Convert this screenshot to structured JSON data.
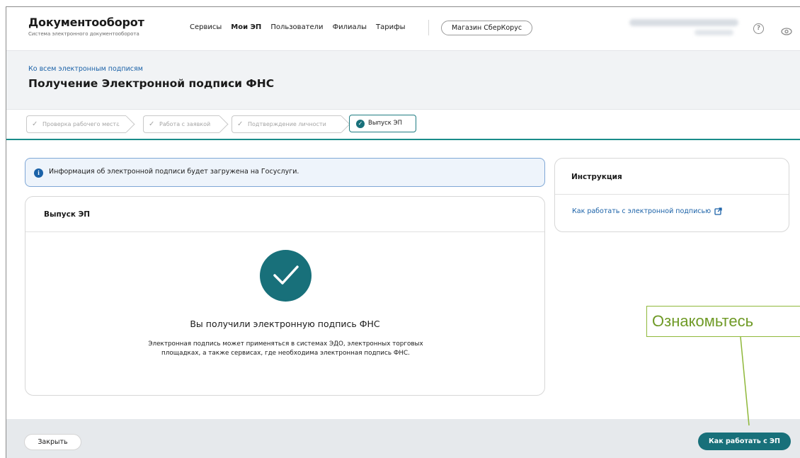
{
  "header": {
    "logo_title": "Документооборот",
    "logo_subtitle": "Система электронного документооборота",
    "nav": [
      {
        "label": "Сервисы",
        "active": false
      },
      {
        "label": "Мои ЭП",
        "active": true
      },
      {
        "label": "Пользователи",
        "active": false
      },
      {
        "label": "Филиалы",
        "active": false
      },
      {
        "label": "Тарифы",
        "active": false
      }
    ],
    "shop_button": "Магазин СберКорус",
    "help_icon": "help-circle-icon",
    "eye_icon": "eye-icon"
  },
  "title_band": {
    "back_link": "Ко всем электронным подписям",
    "page_title": "Получение Электронной подписи ФНС"
  },
  "steps": [
    {
      "label": "Проверка рабочего места",
      "state": "done"
    },
    {
      "label": "Работа с заявкой",
      "state": "done"
    },
    {
      "label": "Подтверждение личности",
      "state": "done"
    },
    {
      "label": "Выпуск ЭП",
      "state": "active"
    }
  ],
  "info": {
    "text": "Информация об электронной подписи будет загружена на Госуслуги."
  },
  "card": {
    "title": "Выпуск ЭП",
    "success_title": "Вы получили электронную подпись ФНС",
    "success_desc": "Электронная подпись может применяться в системах ЭДО, электронных торговых площадках, а также сервисах, где необходима электронная подпись ФНС."
  },
  "instruction": {
    "title": "Инструкция",
    "link": "Как работать с электронной подписью"
  },
  "callout": {
    "text": "Ознакомьтесь"
  },
  "footer": {
    "close_button": "Закрыть",
    "primary_button": "Как работать с ЭП"
  },
  "colors": {
    "accent": "#18707a",
    "link": "#1b62a8",
    "callout": "#8fb83a"
  }
}
